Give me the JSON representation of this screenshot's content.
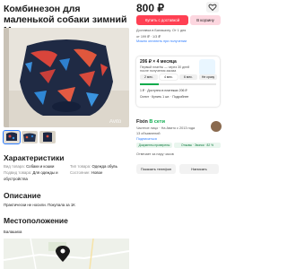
{
  "listing": {
    "title": "Комбинезон для маленькой собаки зимний М",
    "price": "800 ₽",
    "watermark": "Avito"
  },
  "actions": {
    "deliver_label": "Купить с доставкой",
    "cart_label": "В корзину",
    "meta_line1": "Доставка в Балашиху. От 1 дня",
    "meta_line2": "от 199 ₽ · 1/3 ₽",
    "meta_line3": "Можно оплатить при получении"
  },
  "split": {
    "line1": "206 ₽ × 4 месяца",
    "line2": "Первый платёж — через 30 дней",
    "line3": "после получения заказа",
    "options": [
      "2 мес.",
      "4 мес.",
      "6 мес.",
      "Не сразу"
    ],
    "selected_index": 1,
    "foot1": "1 ₽ · Доступно в платежах 206 ₽",
    "foot2": "Сплит · Купить 1 шт. · Подробнее"
  },
  "seller": {
    "name": "Fixin",
    "status": "В сети",
    "line1": "Частное лицо · На Авито с 2013 года",
    "line2": "13 объявлений",
    "link": "Подписаться",
    "badges": [
      "Документы проверены",
      "Отзывы · Звонки · 82 %"
    ],
    "replies": "Отвечает за пару часов",
    "phone_label": "Показать телефон",
    "write_label": "Написать"
  },
  "specs": {
    "heading": "Характеристики",
    "rows": [
      {
        "k": "Вид товара:",
        "v": "Собаки и кошки"
      },
      {
        "k": "Подвид товара:",
        "v": "Для одежды и обустройства"
      },
      {
        "k": "Тип товара:",
        "v": "Одежда обувь"
      },
      {
        "k": "Состояние:",
        "v": "Новое"
      }
    ]
  },
  "description": {
    "heading": "Описание",
    "text": "Практически не носили. Покупала за 1К"
  },
  "location": {
    "heading": "Местоположение",
    "address": "Балашиха"
  },
  "colors": {
    "accent": "#ff4053",
    "cart_bg": "#fcd6df",
    "online": "#0aab4c",
    "link": "#2b7bff"
  }
}
